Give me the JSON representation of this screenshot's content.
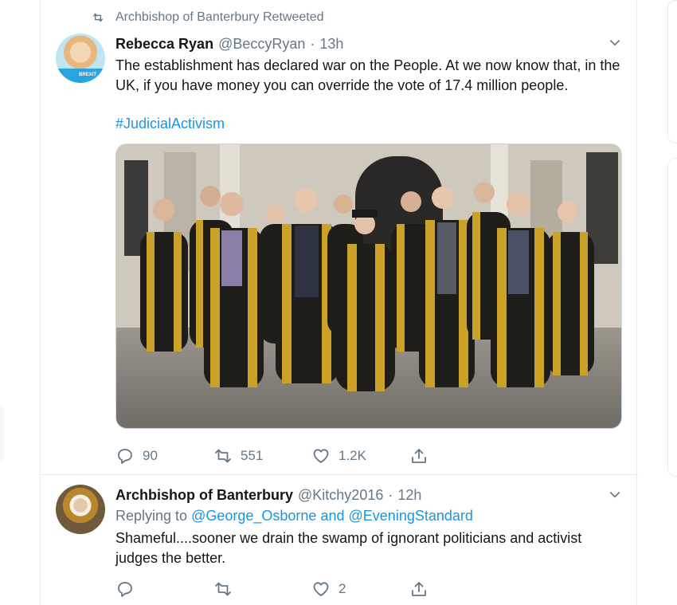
{
  "retweet_banner": {
    "text": "Archbishop of Banterbury Retweeted"
  },
  "tweets": [
    {
      "name": "Rebecca Ryan",
      "handle": "@BeccyRyan",
      "sep": "·",
      "time": "13h",
      "text": "The establishment has declared war on the People. At we now know that, in the UK, if you have money you can override the vote of 17.4 million people.",
      "hashtag": "#JudicialActivism",
      "avatar_badge": "BREXIT",
      "stats": {
        "replies": "90",
        "retweets": "551",
        "likes": "1.2K"
      }
    },
    {
      "name": "Archbishop of Banterbury",
      "handle": "@Kitchy2016",
      "sep": "·",
      "time": "12h",
      "replying_prefix": "Replying to",
      "replying_to_1": "@George_Osborne",
      "replying_and": "and",
      "replying_to_2": "@EveningStandard",
      "text": "Shameful....sooner we drain the swamp of ignorant politicians and activist judges the better.",
      "stats": {
        "replies": "",
        "retweets": "",
        "likes": "2"
      }
    }
  ],
  "colors": {
    "text": "#14171a",
    "secondary": "#657786",
    "link": "#1b95e0",
    "border": "#e6ecf0",
    "robe_black": "#1f1d1a",
    "robe_gold": "#c9a227"
  },
  "icons": [
    "retweet-icon",
    "chevron-down-icon",
    "reply-icon",
    "like-icon",
    "share-icon"
  ]
}
